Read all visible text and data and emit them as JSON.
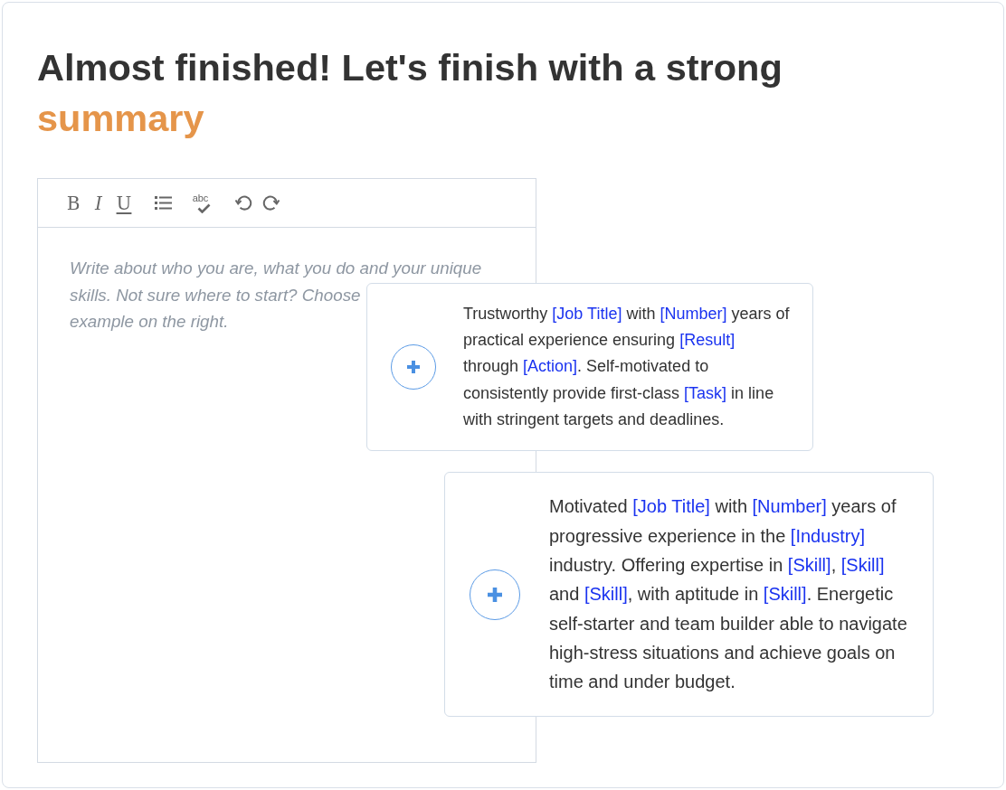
{
  "heading": {
    "text": "Almost finished! Let's finish with a strong",
    "highlight": "summary"
  },
  "editor": {
    "toolbar": [
      {
        "kind": "bold",
        "label": "B"
      },
      {
        "kind": "italic",
        "label": "I"
      },
      {
        "kind": "underline",
        "label": "U"
      },
      {
        "kind": "bullet_list"
      },
      {
        "kind": "spellcheck",
        "label": "abc"
      },
      {
        "kind": "undo"
      },
      {
        "kind": "redo"
      }
    ],
    "placeholder": [
      "Write about who you are, what you do and your unique",
      "skills. Not sure where to start? Choose",
      "example on the right."
    ]
  },
  "suggestions": [
    {
      "segments": [
        {
          "kind": "text",
          "text": "Trustworthy "
        },
        {
          "kind": "field",
          "text": "[Job Title]"
        },
        {
          "kind": "text",
          "text": " with "
        },
        {
          "kind": "field",
          "text": "[Number]"
        },
        {
          "kind": "text",
          "text": " years of practical experience ensuring "
        },
        {
          "kind": "field",
          "text": "[Result]"
        },
        {
          "kind": "text",
          "text": " through "
        },
        {
          "kind": "field",
          "text": "[Action]"
        },
        {
          "kind": "text",
          "text": ". Self-motivated to consistently provide first-class "
        },
        {
          "kind": "field",
          "text": "[Task]"
        },
        {
          "kind": "text",
          "text": " in line with stringent targets and deadlines."
        }
      ]
    },
    {
      "segments": [
        {
          "kind": "text",
          "text": "Motivated "
        },
        {
          "kind": "field",
          "text": "[Job Title]"
        },
        {
          "kind": "text",
          "text": " with "
        },
        {
          "kind": "field",
          "text": "[Number]"
        },
        {
          "kind": "text",
          "text": " years of progressive experience in the "
        },
        {
          "kind": "field",
          "text": "[Industry]"
        },
        {
          "kind": "text",
          "text": " industry. Offering expertise in "
        },
        {
          "kind": "field",
          "text": "[Skill]"
        },
        {
          "kind": "text",
          "text": ", "
        },
        {
          "kind": "field",
          "text": "[Skill]"
        },
        {
          "kind": "text",
          "text": " and "
        },
        {
          "kind": "field",
          "text": "[Skill]"
        },
        {
          "kind": "text",
          "text": ", with aptitude in "
        },
        {
          "kind": "field",
          "text": "[Skill]"
        },
        {
          "kind": "text",
          "text": ". Energetic self-starter and team builder able to navigate high-stress situations and achieve goals on time and under budget."
        }
      ]
    }
  ]
}
